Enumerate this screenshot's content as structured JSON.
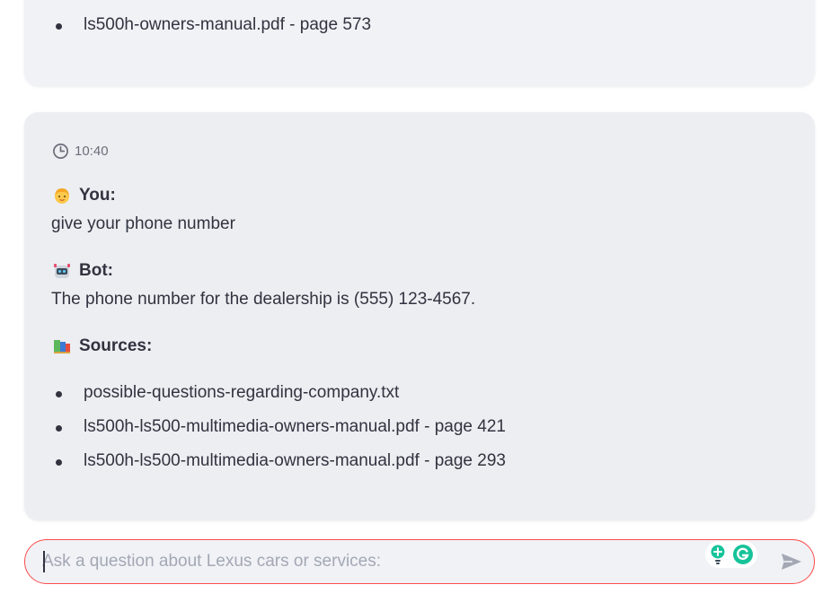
{
  "previous_message": {
    "last_source": "ls500h-owners-manual.pdf - page 573"
  },
  "message": {
    "time": "10:40",
    "user_label": "You:",
    "user_text": "give your phone number",
    "bot_label": "Bot:",
    "bot_text": "The phone number for the dealership is (555) 123-4567.",
    "sources_label": "Sources:",
    "sources": [
      "possible-questions-regarding-company.txt",
      "ls500h-ls500-multimedia-owners-manual.pdf - page 421",
      "ls500h-ls500-multimedia-owners-manual.pdf - page 293"
    ]
  },
  "chat_input": {
    "placeholder": "Ask a question about Lexus cars or services:",
    "value": ""
  },
  "icons": {
    "clock": "clock-icon",
    "user": "person-emoji-icon",
    "bot": "robot-emoji-icon",
    "sources": "books-emoji-icon",
    "send": "send-arrow-icon",
    "grammarly": "grammarly-icon",
    "suggestion": "lightbulb-icon"
  },
  "colors": {
    "accent": "#ff4b4b",
    "card_bg": "#f0f2f6",
    "text": "#31333f",
    "grammarly": "#15c39a"
  }
}
